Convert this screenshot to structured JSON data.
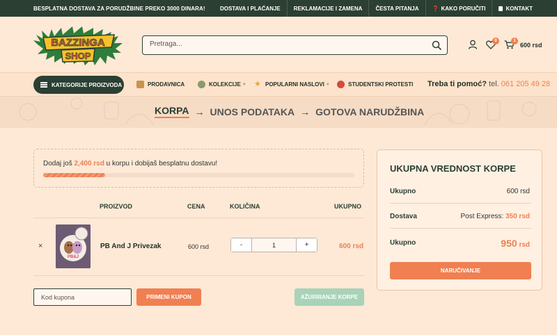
{
  "topbar": {
    "promo": "BESPLATNA DOSTAVA ZA PORUDŽBINE PREKO 3000 DINARA!",
    "links": [
      "DOSTAVA I PLAĆANJE",
      "REKLAMACIJE I ZAMENA",
      "ČESTA PITANJA",
      "KAKO PORUČITI",
      "KONTAKT"
    ]
  },
  "header": {
    "logo_text_top": "BAZZINGA",
    "logo_text_bottom": "SHOP",
    "search_placeholder": "Pretraga...",
    "wishlist_count": "0",
    "cart_count": "1",
    "cart_total": "600 rsd"
  },
  "nav": {
    "categories": "KATEGORIJE PROIZVODA",
    "items": [
      "PRODAVNICA",
      "KOLEKCIJE",
      "POPULARNI NASLOVI",
      "STUDENTSKI PROTESTI"
    ],
    "help_label": "Treba ti pomoć?",
    "help_tel": "tel.",
    "help_number": "061 205 49 28"
  },
  "steps": {
    "current": "KORPA",
    "second": "UNOS PODATAKA",
    "third": "GOTOVA NARUDŽBINA"
  },
  "notice": {
    "prefix": "Dodaj još",
    "amount": "2,400 rsd",
    "suffix": "u korpu i dobijaš besplatnu dostavu!",
    "progress_fraction": 0.2
  },
  "table": {
    "headers": {
      "product": "PROIZVOD",
      "price": "CENA",
      "quantity": "KOLIČINA",
      "subtotal": "UKUPNO"
    },
    "rows": [
      {
        "remove": "×",
        "name": "PB And J Privezak",
        "price": "600 rsd",
        "qty": "1",
        "subtotal": "600 rsd",
        "thumb_text": "PB&J"
      }
    ],
    "minus": "-",
    "plus": "+"
  },
  "coupon": {
    "placeholder": "Kod kupona",
    "apply": "PRIMENI KUPON",
    "update": "AŽURIRANJE KORPE"
  },
  "summary": {
    "title": "UKUPNA VREDNOST KORPE",
    "subtotal_label": "Ukupno",
    "subtotal_value": "600 rsd",
    "shipping_label": "Dostava",
    "shipping_method": "Post Express:",
    "shipping_value": "350 rsd",
    "total_label": "Ukupno",
    "total_amount": "950",
    "total_currency": "rsd",
    "order_button": "NARUČIVANJE"
  },
  "colors": {
    "dark_green": "#2b3f33",
    "accent_orange": "#f07f52",
    "background": "#fde9d6",
    "update_button": "#a8d3b8"
  }
}
